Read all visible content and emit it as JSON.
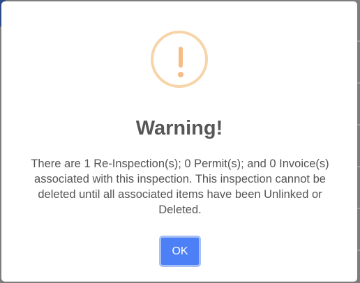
{
  "dialog": {
    "icon": "warning-exclamation-icon",
    "icon_glyph": "!",
    "title": "Warning!",
    "message": "There are 1 Re-Inspection(s); 0 Permit(s); and 0 Invoice(s) associated with this inspection. This inspection cannot be deleted until all associated items have been Unlinked or Deleted.",
    "ok_label": "OK"
  },
  "colors": {
    "icon_ring": "#f8d4a9",
    "icon_mark": "#f7bc86",
    "title_text": "#575757",
    "body_text": "#545454",
    "button_bg": "#4d7ff7",
    "button_focus_ring": "#a6c0f4",
    "overlay": "#7d7d7d"
  }
}
